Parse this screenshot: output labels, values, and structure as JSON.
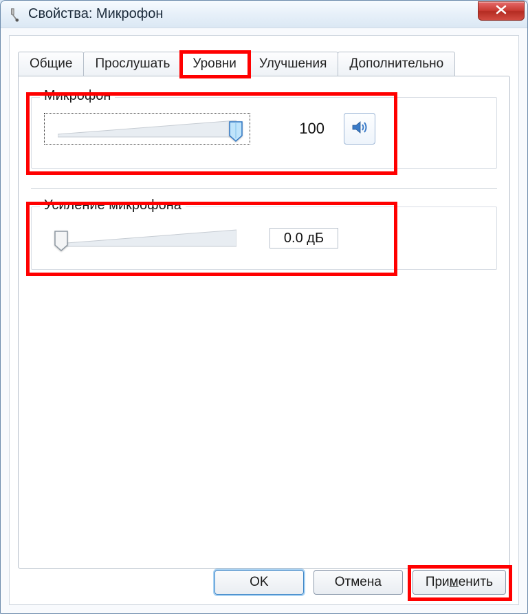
{
  "window": {
    "title": "Свойства: Микрофон"
  },
  "tabs": {
    "items": [
      {
        "label": "Общие"
      },
      {
        "label": "Прослушать"
      },
      {
        "label": "Уровни"
      },
      {
        "label": "Улучшения"
      },
      {
        "label": "Дополнительно"
      }
    ],
    "active_index": 2
  },
  "mic_level": {
    "title": "Микрофон",
    "value_text": "100",
    "percent": 100
  },
  "mic_boost": {
    "title": "Усиление микрофона",
    "value_text": "0.0 дБ",
    "percent": 0
  },
  "buttons": {
    "ok": "OK",
    "cancel": "Отмена",
    "apply": "Применить",
    "apply_underline_char": "м"
  },
  "icons": {
    "close": "close-icon",
    "title": "microphone-icon",
    "speaker": "speaker-icon"
  },
  "colors": {
    "highlight": "#ff0000",
    "accent_blue": "#2f77c4"
  }
}
